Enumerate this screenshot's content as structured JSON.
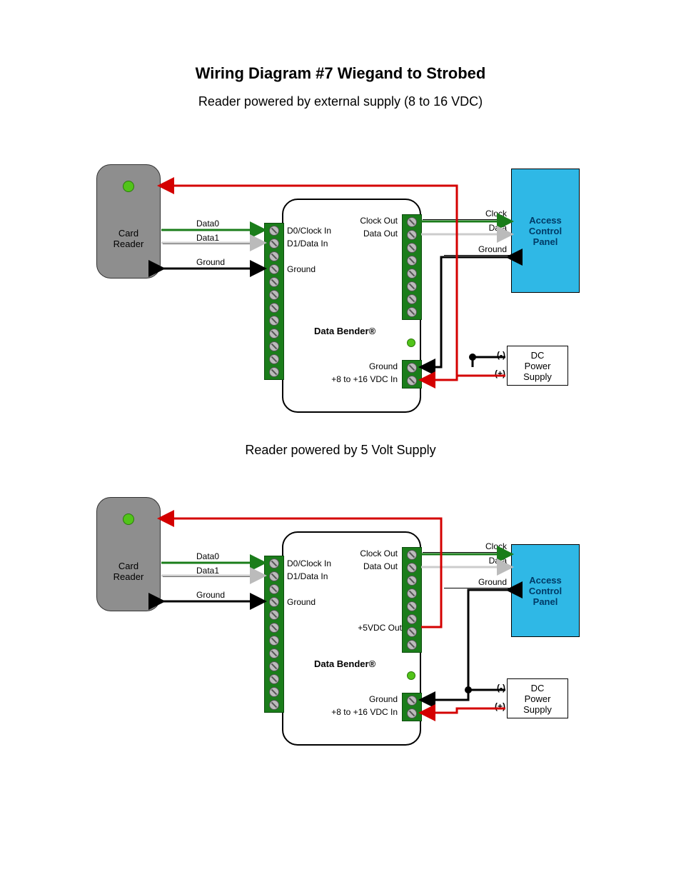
{
  "title": "Wiring Diagram  #7 Wiegand to Strobed",
  "subtitle_top": "Reader powered by external supply (8 to 16 VDC)",
  "subtitle_mid": "Reader powered by 5 Volt Supply",
  "reader": {
    "name": "Card\nReader"
  },
  "panel": {
    "name": "Access\nControl\nPanel"
  },
  "psu": {
    "name": "DC\nPower\nSupply",
    "neg": "(-)",
    "pos": "(+)"
  },
  "bender": {
    "name": "Data Bender®",
    "left": {
      "d0": "D0/Clock In",
      "d1": "D1/Data In",
      "gnd": "Ground"
    },
    "right_top": {
      "clock": "Clock Out",
      "data": "Data Out",
      "five": "+5VDC Out"
    },
    "right_bot": {
      "gnd": "Ground",
      "vin": "+8 to +16 VDC In"
    }
  },
  "wires": {
    "data0": "Data0",
    "data1": "Data1",
    "ground": "Ground",
    "clock": "Clock",
    "data": "Data"
  }
}
